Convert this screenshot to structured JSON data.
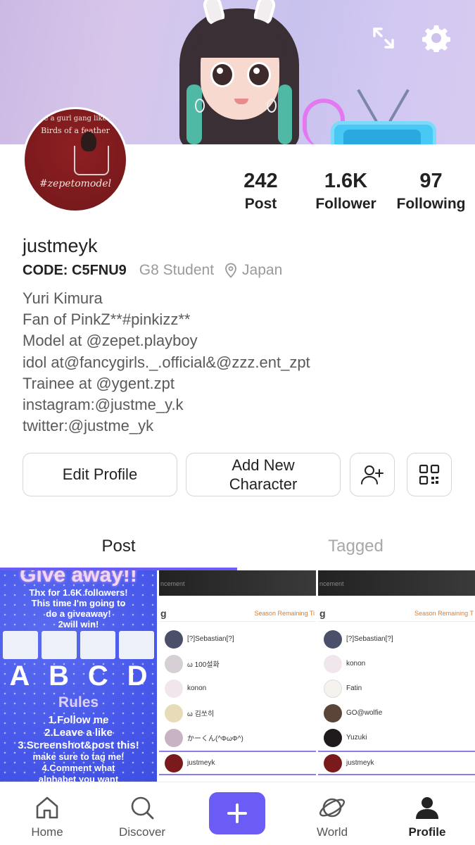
{
  "profile": {
    "username": "justmeyk",
    "code": "CODE: C5FNU9",
    "school": "G8 Student",
    "location": "Japan",
    "bio": [
      "Yuri Kimura",
      "Fan of PinkZ**#pinkizz**",
      "Model at @zepet.playboy",
      "idol at@fancygirls._.official&@zzz.ent_zpt",
      "Trainee at @ygent.zpt",
      "instagram:@justme_y.k",
      "twitter:@justme_yk"
    ],
    "avatar_text": [
      "e a gurl gang like",
      "Birds of a feather",
      "#zepetomodel"
    ]
  },
  "stats": [
    {
      "value": "242",
      "label": "Post"
    },
    {
      "value": "1.6K",
      "label": "Follower"
    },
    {
      "value": "97",
      "label": "Following"
    }
  ],
  "actions": {
    "edit_profile": "Edit Profile",
    "add_character_line1": "Add New",
    "add_character_line2": "Character"
  },
  "tabs": {
    "post": "Post",
    "tagged": "Tagged"
  },
  "grid": {
    "giveaway": {
      "title": "Give away!!",
      "lines": [
        "Thx for 1.6K followers!",
        "This time I'm going to",
        "do a giveaway!",
        "2will win!"
      ],
      "letters": [
        "A",
        "B",
        "C",
        "D"
      ],
      "rules_title": "Rules",
      "rules": [
        "1.Follow me",
        "2.Leave a like",
        "3.Screenshot&post this!",
        "make sure to tag me!",
        "4.Comment what",
        "alphabet you want"
      ]
    },
    "rank1": {
      "strip": "ncement",
      "g": "g",
      "season": "Season Remaining Ti",
      "rows": [
        "[?]Sebastian[?]",
        "ω 100설화",
        "konon",
        "ω 김쏘히",
        "かーくん(^ΦωΦ^)",
        "justmeyk"
      ]
    },
    "rank2": {
      "strip": "ncement",
      "g": "g",
      "season": "Season Remaining T",
      "rows": [
        "[?]Sebastian[?]",
        "konon",
        "Fatin",
        "GO@wolfie",
        "Yuzuki",
        "justmeyk"
      ]
    }
  },
  "nav": {
    "home": "Home",
    "discover": "Discover",
    "world": "World",
    "profile": "Profile"
  },
  "colors": {
    "accent": "#6b5cf5",
    "giveaway_bg": "#4858ea",
    "avatar_bg": "#7a1a1d"
  }
}
